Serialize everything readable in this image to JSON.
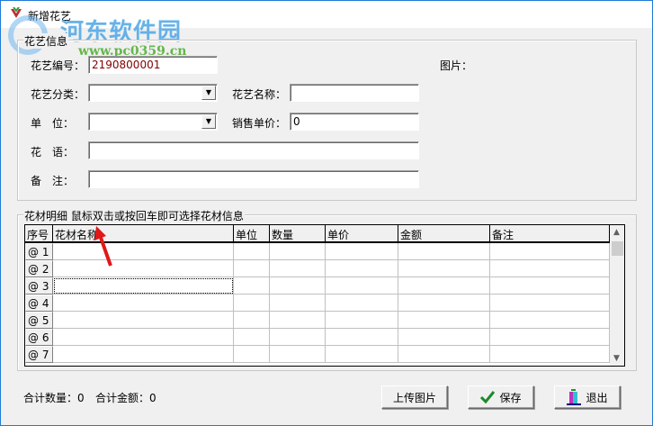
{
  "window": {
    "title": "新增花艺"
  },
  "watermark": {
    "name": "河东软件园",
    "url": "www.pc0359.cn"
  },
  "info_group": {
    "title": "花艺信息",
    "code_label": "花艺编号：",
    "code_value": "2190800001",
    "picture_label": "图片：",
    "category_label": "花艺分类：",
    "category_value": "",
    "name_label": "花艺名称：",
    "name_value": "",
    "unit_label": "单　位：",
    "unit_value": "",
    "price_label": "销售单价：",
    "price_value": "0",
    "language_label": "花　语：",
    "language_value": "",
    "remark_label": "备　注：",
    "remark_value": ""
  },
  "detail_group": {
    "title": "花材明细  鼠标双击或按回车即可选择花材信息",
    "columns": [
      "序号",
      "花材名称",
      "单位",
      "数量",
      "单价",
      "金额",
      "备注"
    ],
    "rows": [
      "@ 1",
      "@ 2",
      "@ 3",
      "@ 4",
      "@ 5",
      "@ 6",
      "@ 7"
    ]
  },
  "footer": {
    "total_qty_label": "合计数量：",
    "total_qty": "0",
    "total_amount_label": "合计金额：",
    "total_amount": "0",
    "upload_label": "上传图片",
    "save_label": "保存",
    "exit_label": "退出"
  }
}
